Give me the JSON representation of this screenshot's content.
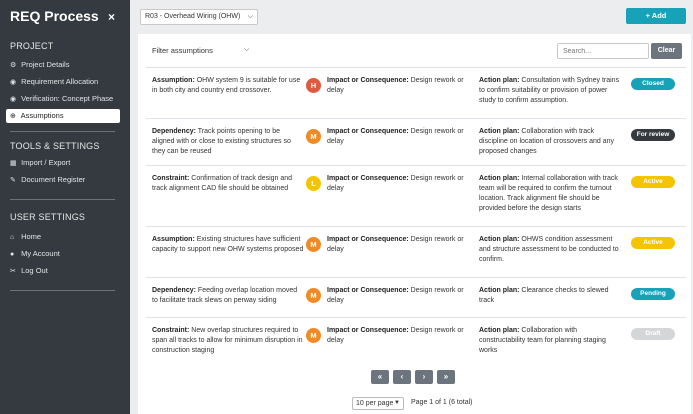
{
  "sidebar": {
    "brand": "REQ Process",
    "close_label": "×",
    "project_title": "PROJECT",
    "project_items": [
      {
        "icon": "gear-icon",
        "glyph": "⚙",
        "label": "Project Details"
      },
      {
        "icon": "globe-icon",
        "glyph": "◉",
        "label": "Requirement Allocation"
      },
      {
        "icon": "check-circle-icon",
        "glyph": "◉",
        "label": "Verification: Concept Phase"
      },
      {
        "icon": "plus-circle-icon",
        "glyph": "⊕",
        "label": "Assumptions"
      }
    ],
    "tools_title": "TOOLS & SETTINGS",
    "tools_items": [
      {
        "icon": "table-icon",
        "glyph": "▦",
        "label": "Import / Export"
      },
      {
        "icon": "edit-icon",
        "glyph": "✎",
        "label": "Document Register"
      }
    ],
    "user_title": "USER SETTINGS",
    "user_items": [
      {
        "icon": "home-icon",
        "glyph": "⌂",
        "label": "Home"
      },
      {
        "icon": "user-icon",
        "glyph": "●",
        "label": "My Account"
      },
      {
        "icon": "wrench-icon",
        "glyph": "✂",
        "label": "Log Out"
      }
    ]
  },
  "topbar": {
    "project_select": "R03 - Overhead Wiring (OHW)",
    "add_label": "+ Add"
  },
  "filters": {
    "filter_label": "Filter assumptions",
    "search_placeholder": "Search...",
    "clear_label": "Clear"
  },
  "rows": [
    {
      "type": "Assumption:",
      "text": "OHW system 9 is suitable for use in both city and country end crossover.",
      "level": "H",
      "impact_label": "Impact or Consequence:",
      "impact": "Design rework or delay",
      "action_label": "Action plan:",
      "action": "Consultation with Sydney trains to confirm suitability or provision of power study to confirm assumption.",
      "status": "Closed"
    },
    {
      "type": "Dependency:",
      "text": "Track points opening to be aligned with or close to existing structures so they can be reused",
      "level": "M",
      "impact_label": "Impact or Consequence:",
      "impact": "Design rework or delay",
      "action_label": "Action plan:",
      "action": "Collaboration with track discipline on location of crossovers and any proposed changes",
      "status": "For review"
    },
    {
      "type": "Constraint:",
      "text": "Confirmation of track design and track alignment CAD file should be obtained",
      "level": "L",
      "impact_label": "Impact or Consequence:",
      "impact": "Design rework or delay",
      "action_label": "Action plan:",
      "action": "Internal collaboration with track team will be required to confirm the turnout location. Track alignment file should be provided before the design starts",
      "status": "Active"
    },
    {
      "type": "Assumption:",
      "text": "Existing structures have sufficient capacity to support new OHW systems proposed",
      "level": "M",
      "impact_label": "Impact or Consequence:",
      "impact": "Design rework or delay",
      "action_label": "Action plan:",
      "action": "OHWS condition assessment and structure assessment to be conducted to confirm.",
      "status": "Active"
    },
    {
      "type": "Dependency:",
      "text": "Feeding overlap location moved to facilitate track slews on perway siding",
      "level": "M",
      "impact_label": "Impact or Consequence:",
      "impact": "Design rework or delay",
      "action_label": "Action plan:",
      "action": "Clearance checks to slewed track",
      "status": "Pending"
    },
    {
      "type": "Constraint:",
      "text": "New overlap structures required to span all tracks to allow for minimum disruption in construction staging",
      "level": "M",
      "impact_label": "Impact or Consequence:",
      "impact": "Design rework or delay",
      "action_label": "Action plan:",
      "action": "Collaboration with constructability team for planning staging works",
      "status": "Draft"
    }
  ],
  "level_colors": {
    "H": "#e05a3f",
    "M": "#f08a24",
    "L": "#f5c400"
  },
  "status_colors": {
    "Closed": "#17a2b8",
    "For review": "#343a40",
    "Active": "#f5c400",
    "Pending": "#17a2b8",
    "Draft": "#d4d6d8"
  },
  "pagination": {
    "first": "«",
    "prev": "‹",
    "next": "›",
    "last": "»",
    "per_page": "10 per page",
    "info": "Page 1 of 1 (6 total)"
  }
}
